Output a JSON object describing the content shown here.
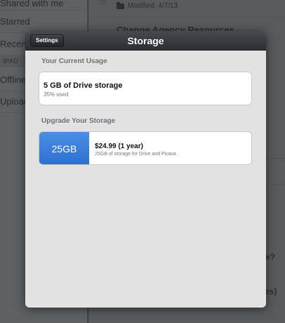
{
  "background": {
    "sidebar": {
      "items": [
        {
          "label": "Shared with me"
        },
        {
          "label": "Starred"
        },
        {
          "label": "Recent"
        },
        {
          "label": "Offline"
        },
        {
          "label": "Upload"
        }
      ],
      "section_header": "IPAD"
    },
    "main": {
      "modified": "Modified: 4/7/13",
      "folder_title": "Change Agency Resources",
      "fragment_1": "e?",
      "fragment_2": "es)"
    }
  },
  "modal": {
    "back_button": "Settings",
    "title": "Storage",
    "current_usage": {
      "heading": "Your Current Usage",
      "storage": "5 GB of Drive storage",
      "used": "35% used"
    },
    "upgrade": {
      "heading": "Upgrade Your Storage",
      "plan": {
        "size": "25GB",
        "price": "$24.99 (1 year)",
        "description": "25GB of storage for Drive and Picasa",
        "badge_color": "#3a7ed9"
      }
    }
  }
}
